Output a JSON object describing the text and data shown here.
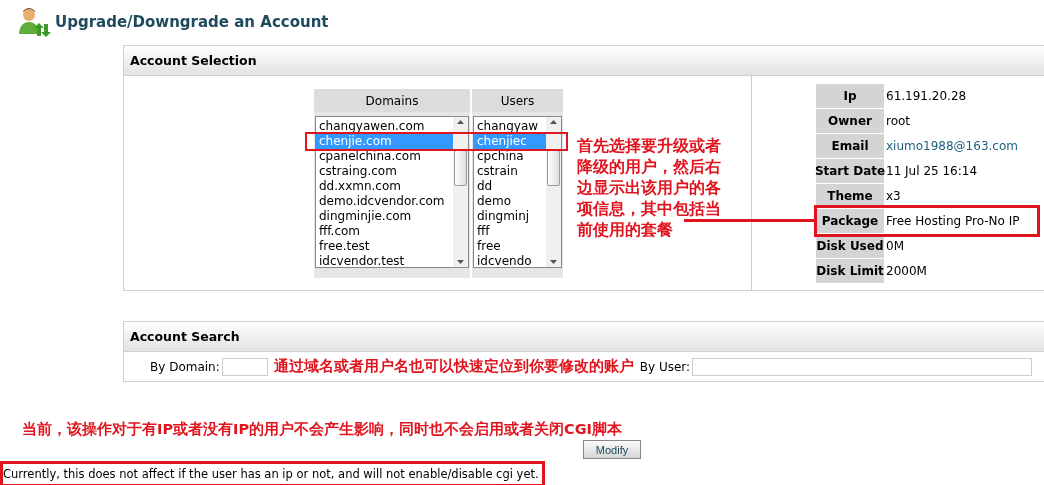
{
  "page": {
    "title": "Upgrade/Downgrade an Account"
  },
  "account_selection": {
    "title": "Account Selection",
    "domains": {
      "heading": "Domains",
      "items": [
        {
          "label": "changyawen.com",
          "selected": false
        },
        {
          "label": "chenjie.com",
          "selected": true
        },
        {
          "label": "cpanelchina.com",
          "selected": false
        },
        {
          "label": "cstraing.com",
          "selected": false
        },
        {
          "label": "dd.xxmn.com",
          "selected": false
        },
        {
          "label": "demo.idcvendor.com",
          "selected": false
        },
        {
          "label": "dingminjie.com",
          "selected": false
        },
        {
          "label": "fff.com",
          "selected": false
        },
        {
          "label": "free.test",
          "selected": false
        },
        {
          "label": "idcvendor.test",
          "selected": false
        }
      ]
    },
    "users": {
      "heading": "Users",
      "items": [
        {
          "label": "changyaw",
          "selected": false
        },
        {
          "label": "chenjiec",
          "selected": true
        },
        {
          "label": "cpchina",
          "selected": false
        },
        {
          "label": "cstrain",
          "selected": false
        },
        {
          "label": "dd",
          "selected": false
        },
        {
          "label": "demo",
          "selected": false
        },
        {
          "label": "dingminj",
          "selected": false
        },
        {
          "label": "fff",
          "selected": false
        },
        {
          "label": "free",
          "selected": false
        },
        {
          "label": "idcvendo",
          "selected": false
        }
      ]
    },
    "note": "首先选择要升级或者降级的用户，然后右边显示出该用户的各项信息，其中包括当前使用的套餐",
    "info": [
      {
        "label": "Ip",
        "value": "61.191.20.28",
        "kind": "text",
        "highlighted": false
      },
      {
        "label": "Owner",
        "value": "root",
        "kind": "text",
        "highlighted": false
      },
      {
        "label": "Email",
        "value": "xiumo1988@163.com",
        "kind": "link",
        "highlighted": false
      },
      {
        "label": "Start Date",
        "value": "11 Jul 25 16:14",
        "kind": "text",
        "highlighted": false
      },
      {
        "label": "Theme",
        "value": "x3",
        "kind": "text",
        "highlighted": false
      },
      {
        "label": "Package",
        "value": "Free Hosting Pro-No IP",
        "kind": "text",
        "highlighted": true
      },
      {
        "label": "Disk Used",
        "value": "0M",
        "kind": "text",
        "highlighted": false
      },
      {
        "label": "Disk Limit",
        "value": "2000M",
        "kind": "text",
        "highlighted": false
      }
    ]
  },
  "account_search": {
    "title": "Account Search",
    "by_domain_label": "By Domain:",
    "by_user_label": "By User:",
    "note": "通过域名或者用户名也可以快速定位到你要修改的账户"
  },
  "footer": {
    "note_zh": "当前，该操作对于有IP或者没有IP的用户不会产生影响，同时也不会启用或者关闭CGI脚本",
    "modify_button": "Modify",
    "note": "Currently, this does not affect if the user has an ip or not, and will not enable/disable cgi yet."
  }
}
